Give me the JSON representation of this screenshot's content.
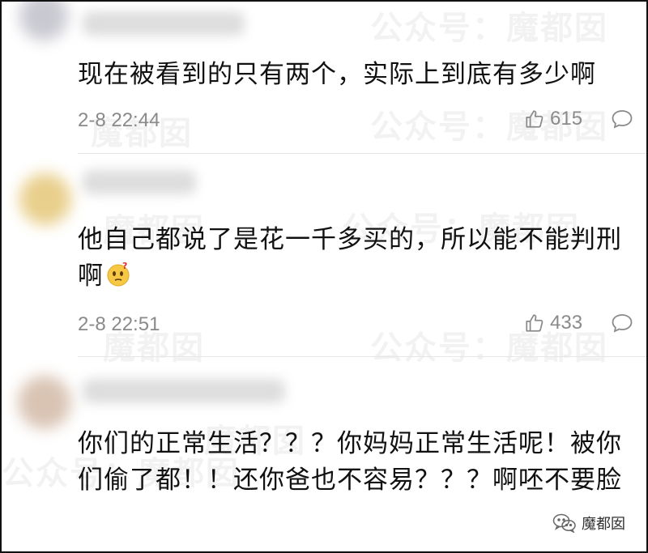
{
  "watermark_text": "魔都囡",
  "watermark_full": "公众号：魔都囡",
  "comments": [
    {
      "text": "现在被看到的只有两个，实际上到底有多少啊",
      "time": "2-8 22:44",
      "likes": "615"
    },
    {
      "text": "他自己都说了是花一千多买的，所以能不能判刑啊",
      "time": "2-8 22:51",
      "likes": "433",
      "emoji": "thinking-face-icon"
    },
    {
      "text": "你们的正常生活？？？你妈妈正常生活呢！被你们偷了都！！还你爸也不容易？？？啊呸不要脸"
    }
  ],
  "badge": {
    "label": "魔都囡"
  },
  "colors": {
    "text": "#111111",
    "meta": "#8a8a8a",
    "divider": "#e6e6e6"
  }
}
